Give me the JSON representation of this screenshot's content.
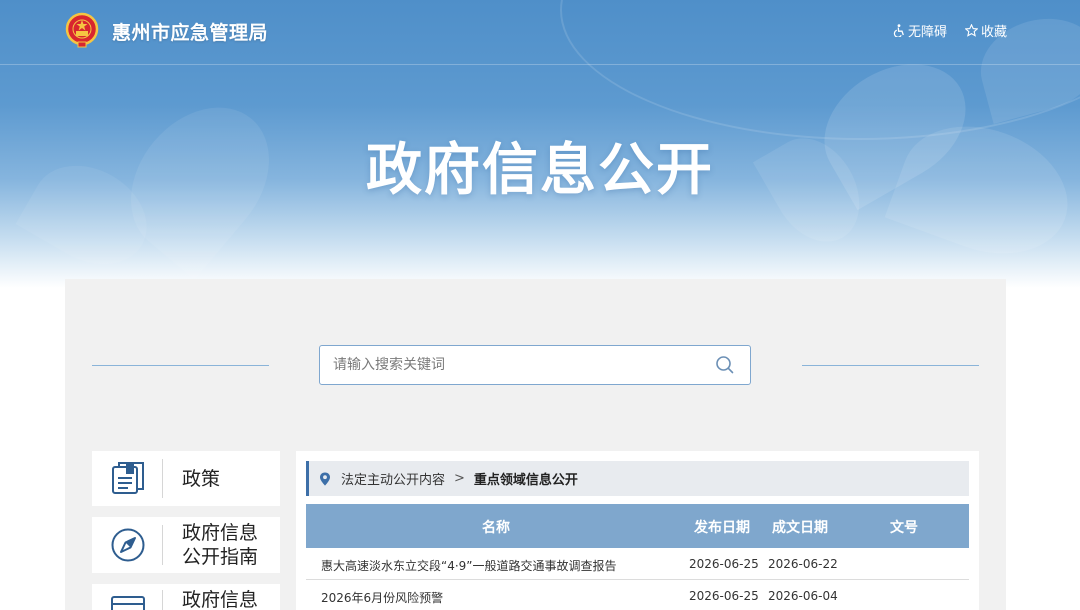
{
  "header": {
    "site_name": "惠州市应急管理局",
    "accessibility": "无障碍",
    "favorite": "收藏"
  },
  "hero": {
    "title": "政府信息公开"
  },
  "search": {
    "placeholder": "请输入搜索关键词"
  },
  "sidebar": {
    "items": [
      {
        "label": "政策"
      },
      {
        "label_line1": "政府信息",
        "label_line2": "公开指南"
      },
      {
        "label": "政府信息"
      }
    ]
  },
  "breadcrumb": {
    "parent": "法定主动公开内容",
    "current": "重点领域信息公开"
  },
  "table": {
    "headers": {
      "name": "名称",
      "published": "发布日期",
      "document_date": "成文日期",
      "doc_number": "文号"
    },
    "rows": [
      {
        "name": "惠大高速淡水东立交段“4·9”一般道路交通事故调查报告",
        "published": "2026-06-25",
        "document_date": "2026-06-22",
        "doc_number": ""
      },
      {
        "name": "2026年6月份风险预警",
        "published": "2026-06-25",
        "document_date": "2026-06-04",
        "doc_number": ""
      }
    ]
  },
  "colors": {
    "banner": "#5d9ad0",
    "accent": "#3d6fa8",
    "table_header": "#7fa7cd",
    "panel_bg": "#f1f1f1"
  },
  "icons": {
    "emblem": "national-emblem-icon",
    "accessibility": "wheelchair-icon",
    "favorite": "star-icon",
    "search": "search-icon",
    "policy": "book-icon",
    "guide": "compass-icon",
    "info": "document-list-icon",
    "breadcrumb": "location-pin-icon"
  }
}
